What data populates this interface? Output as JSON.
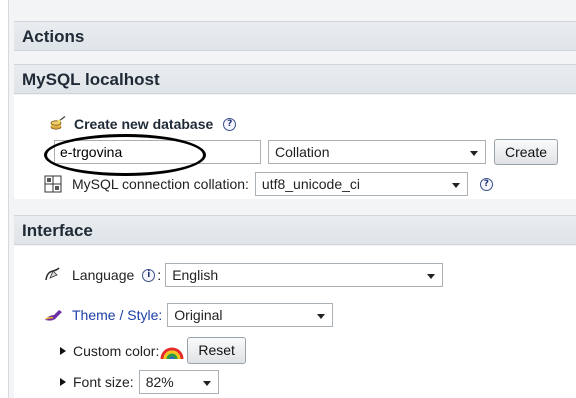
{
  "actions": {
    "title": "Actions"
  },
  "mysql": {
    "title": "MySQL localhost",
    "create_db": {
      "label": "Create new database",
      "name_value": "e-trgovina",
      "collation_selected": "Collation",
      "create_button": "Create"
    },
    "connection_collation": {
      "label": "MySQL connection collation:",
      "selected": "utf8_unicode_ci"
    }
  },
  "interface": {
    "title": "Interface",
    "language": {
      "label": "Language",
      "colon": ":",
      "selected": "English"
    },
    "theme": {
      "label": "Theme / Style:",
      "selected": "Original"
    },
    "custom_color": {
      "label": "Custom color:",
      "reset_button": "Reset"
    },
    "font_size": {
      "label": "Font size:",
      "selected": "82%"
    }
  },
  "icons": {
    "help": "help-icon",
    "create_db": "database-wand-icon",
    "collation": "collation-grid-icon",
    "language": "language-icon",
    "theme": "paint-brush-icon",
    "color": "rainbow-icon"
  },
  "colors": {
    "link": "#1c3ea7",
    "header_bg": "#e3e8ec",
    "header_text": "#1f2a36"
  }
}
